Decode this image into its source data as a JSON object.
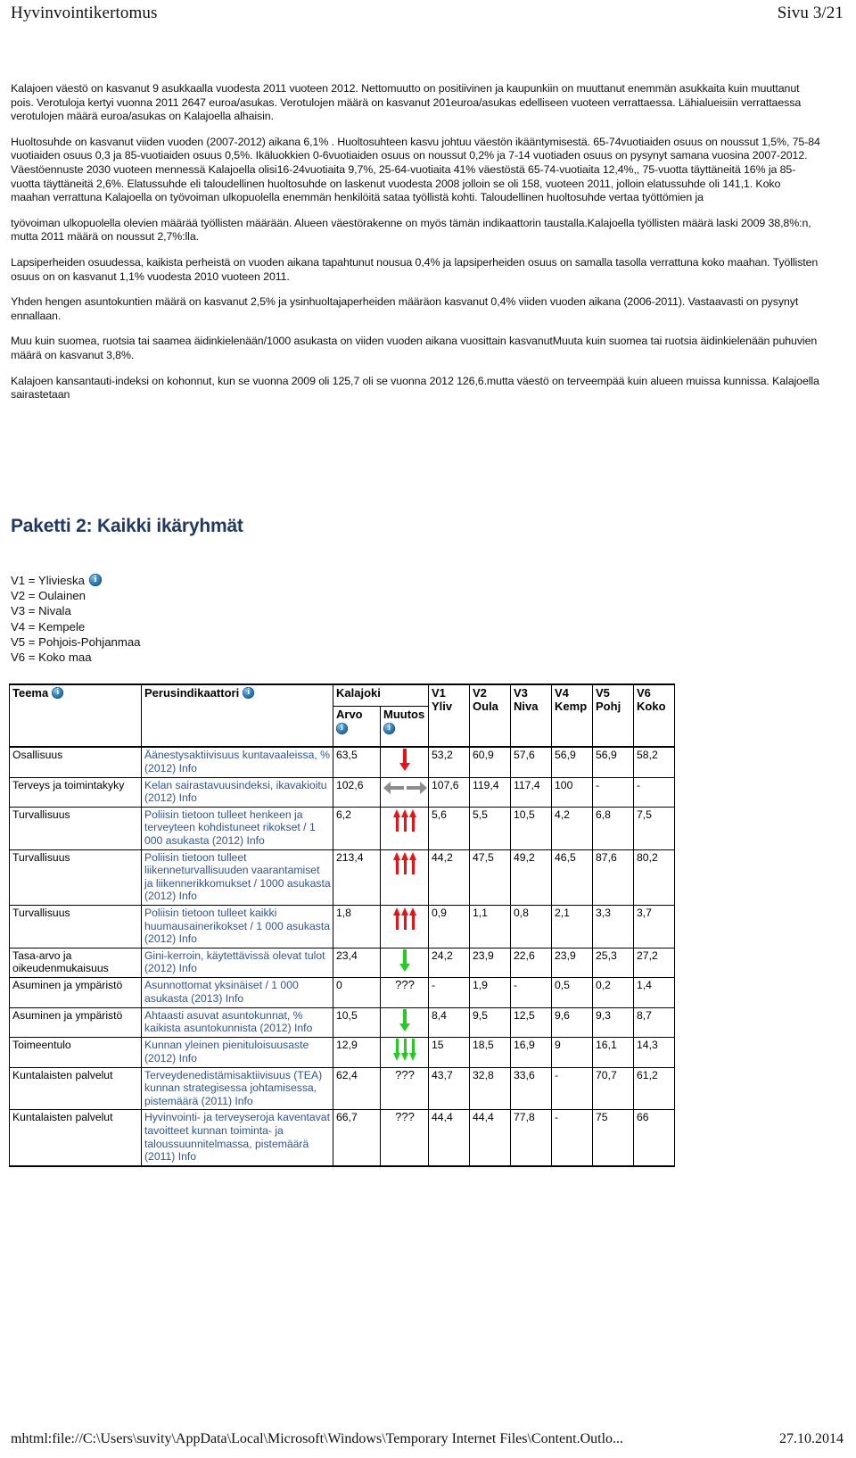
{
  "header": {
    "title": "Hyvinvointikertomus",
    "page_label": "Sivu 3/21"
  },
  "body_paragraphs": [
    "Kalajoen väestö on kasvanut 9 asukkaalla vuodesta 2011 vuoteen 2012. Nettomuutto on positiivinen ja kaupunkiin on muuttanut enemmän asukkaita kuin muuttanut pois. Verotuloja kertyi vuonna 2011  2647 euroa/asukas. Verotulojen määrä on kasvanut 201euroa/asukas edelliseen vuoteen verrattaessa. Lähialueisiin verrattaessa verotulojen määrä euroa/asukas on Kalajoella alhaisin.",
    "Huoltosuhde on kasvanut viiden vuoden (2007-2012) aikana 6,1% . Huoltosuhteen kasvu johtuu väestön ikääntymisestä. 65-74vuotiaiden osuus on noussut 1,5%, 75-84 vuotiaiden osuus 0,3  ja 85-vuotiaiden osuus 0,5%. Ikäluokkien 0-6vuotiaiden osuus on noussut 0,2% ja 7-14 vuotiaden osuus on pysynyt samana vuosina 2007-2012. Väestöennuste 2030 vuoteen mennessä Kalajoella olisi16-24vuotiaita 9,7%, 25-64-vuotiaita 41%  väestöstä  65-74-vuotiaita 12,4%,, 75-vuotta täyttäneitä 16% ja 85-vuotta täyttäneitä 2,6%. Elatussuhde eli taloudellinen huoltosuhde on laskenut vuodesta 2008 jolloin se oli 158, vuoteen 2011, jolloin elatussuhde oli 141,1. Koko maahan verrattuna Kalajoella on työvoiman ulkopuolella enemmän henkilöitä sataa työllistä kohti. Taloudellinen huoltosuhde vertaa työttömien ja",
    "työvoiman ulkopuolella olevien määrää työllisten määrään. Alueen väestörakenne on myös tämän indikaattorin taustalla.Kalajoella työllisten määrä laski 2009 38,8%:n, mutta 2011 määrä on noussut 2,7%:lla.",
    "Lapsiperheiden osuudessa, kaikista perheistä on vuoden aikana tapahtunut nousua 0,4% ja lapsiperheiden osuus on samalla tasolla verrattuna koko maahan. Työllisten osuus on on kasvanut 1,1% vuodesta 2010 vuoteen 2011.",
    "Yhden hengen asuntokuntien määrä on kasvanut 2,5% ja ysinhuoltajaperheiden määräon kasvanut 0,4% viiden vuoden aikana (2006-2011). Vastaavasti on pysynyt ennallaan.",
    "Muu kuin suomea, ruotsia tai saamea äidinkielenään/1000 asukasta on viiden vuoden aikana vuosittain kasvanutMuuta kuin suomea tai ruotsia äidinkielenään puhuvien määrä on kasvanut 3,8%.",
    "Kalajoen  kansantauti-indeksi on kohonnut, kun se vuonna 2009 oli 125,7 oli se vuonna 2012 126,6.mutta väestö on terveempää kuin alueen muissa kunnissa. Kalajoella sairastetaan"
  ],
  "section_heading": "Paketti 2: Kaikki ikäryhmät",
  "legend": {
    "items": [
      "V1 = Ylivieska",
      "V2 = Oulainen",
      "V3 = Nivala",
      "V4 = Kempele",
      "V5 = Pohjois-Pohjanmaa",
      "V6 = Koko maa"
    ],
    "info_icon": "info-icon"
  },
  "table": {
    "headers": {
      "theme": "Teema",
      "indicator": "Perusindikaattori",
      "group_kalajoki": "Kalajoki",
      "arvo": "Arvo",
      "muutos": "Muutos",
      "v1_code": "V1",
      "v1_name": "Yliv",
      "v2_code": "V2",
      "v2_name": "Oula",
      "v3_code": "V3",
      "v3_name": "Niva",
      "v4_code": "V4",
      "v4_name": "Kemp",
      "v5_code": "V5",
      "v5_name": "Pohj",
      "v6_code": "V6",
      "v6_name": "Koko"
    },
    "rows": [
      {
        "theme": "Osallisuus",
        "indicator": "Äänestysaktiivisuus kuntavaaleissa, % (2012) Info",
        "arvo": "63,5",
        "change": {
          "type": "arrow",
          "direction": "down",
          "color": "#ee1111",
          "count": 1,
          "text": ""
        },
        "v1": "53,2",
        "v2": "60,9",
        "v3": "57,6",
        "v4": "56,9",
        "v5": "56,9",
        "v6": "58,2"
      },
      {
        "theme": "Terveys ja toimintakyky",
        "indicator": "Kelan sairastavuusindeksi, ikavakioitu (2012) Info",
        "arvo": "102,6",
        "change": {
          "type": "leftright",
          "direction": "both",
          "color": "#8d8d8d",
          "count": 2,
          "text": ""
        },
        "v1": "107,6",
        "v2": "119,4",
        "v3": "117,4",
        "v4": "100",
        "v5": "-",
        "v6": "-"
      },
      {
        "theme": "Turvallisuus",
        "indicator": "Poliisin tietoon tulleet henkeen ja terveyteen kohdistuneet rikokset / 1 000 asukasta (2012) Info",
        "arvo": "6,2",
        "change": {
          "type": "arrow",
          "direction": "up",
          "color": "#ee1111",
          "count": 3,
          "text": ""
        },
        "v1": "5,6",
        "v2": "5,5",
        "v3": "10,5",
        "v4": "4,2",
        "v5": "6,8",
        "v6": "7,5"
      },
      {
        "theme": "Turvallisuus",
        "indicator": "Poliisin tietoon tulleet liikenneturvallisuuden vaarantamiset ja liikennerikkomukset / 1000 asukasta (2012) Info",
        "arvo": "213,4",
        "change": {
          "type": "arrow",
          "direction": "up",
          "color": "#ee1111",
          "count": 3,
          "text": ""
        },
        "v1": "44,2",
        "v2": "47,5",
        "v3": "49,2",
        "v4": "46,5",
        "v5": "87,6",
        "v6": "80,2"
      },
      {
        "theme": "Turvallisuus",
        "indicator": "Poliisin tietoon tulleet kaikki huumausainerikokset / 1 000 asukasta (2012) Info",
        "arvo": "1,8",
        "change": {
          "type": "arrow",
          "direction": "up",
          "color": "#ee1111",
          "count": 3,
          "text": ""
        },
        "v1": "0,9",
        "v2": "1,1",
        "v3": "0,8",
        "v4": "2,1",
        "v5": "3,3",
        "v6": "3,7"
      },
      {
        "theme": "Tasa-arvo ja oikeudenmukaisuus",
        "indicator": "Gini-kerroin, käytettävissä olevat tulot (2012) Info",
        "arvo": "23,4",
        "change": {
          "type": "arrow",
          "direction": "down",
          "color": "#22cc22",
          "count": 1,
          "text": ""
        },
        "v1": "24,2",
        "v2": "23,9",
        "v3": "22,6",
        "v4": "23,9",
        "v5": "25,3",
        "v6": "27,2"
      },
      {
        "theme": "Asuminen ja ympäristö",
        "indicator": "Asunnottomat yksinäiset / 1 000 asukasta (2013) Info",
        "arvo": "0",
        "change": {
          "type": "text",
          "direction": "",
          "color": "#000000",
          "count": 0,
          "text": "???"
        },
        "v1": "-",
        "v2": "1,9",
        "v3": "-",
        "v4": "0,5",
        "v5": "0,2",
        "v6": "1,4"
      },
      {
        "theme": "Asuminen ja ympäristö",
        "indicator": "Ahtaasti asuvat asuntokunnat, % kaikista asuntokunnista (2012) Info",
        "arvo": "10,5",
        "change": {
          "type": "arrow",
          "direction": "down",
          "color": "#22cc22",
          "count": 1,
          "text": ""
        },
        "v1": "8,4",
        "v2": "9,5",
        "v3": "12,5",
        "v4": "9,6",
        "v5": "9,3",
        "v6": "8,7"
      },
      {
        "theme": "Toimeentulo",
        "indicator": "Kunnan yleinen pienituloisuusaste (2012) Info",
        "arvo": "12,9",
        "change": {
          "type": "arrow",
          "direction": "down",
          "color": "#22cc22",
          "count": 3,
          "text": ""
        },
        "v1": "15",
        "v2": "18,5",
        "v3": "16,9",
        "v4": "9",
        "v5": "16,1",
        "v6": "14,3"
      },
      {
        "theme": "Kuntalaisten palvelut",
        "indicator": "Terveydenedistämisaktiivisuus (TEA) kunnan strategisessa johtamisessa, pistemäärä (2011) Info",
        "arvo": "62,4",
        "change": {
          "type": "text",
          "direction": "",
          "color": "#000000",
          "count": 0,
          "text": "???"
        },
        "v1": "43,7",
        "v2": "32,8",
        "v3": "33,6",
        "v4": "-",
        "v5": "70,7",
        "v6": "61,2"
      },
      {
        "theme": "Kuntalaisten palvelut",
        "indicator": "Hyvinvointi- ja terveyseroja kaventavat tavoitteet kunnan toiminta- ja taloussuunnitelmassa, pistemäärä (2011) Info",
        "arvo": "66,7",
        "change": {
          "type": "text",
          "direction": "",
          "color": "#000000",
          "count": 0,
          "text": "???"
        },
        "v1": "44,4",
        "v2": "44,4",
        "v3": "77,8",
        "v4": "-",
        "v5": "75",
        "v6": "66"
      }
    ]
  },
  "footer": {
    "path": "mhtml:file://C:\\Users\\suvity\\AppData\\Local\\Microsoft\\Windows\\Temporary Internet Files\\Content.Outlo...",
    "date": "27.10.2014"
  },
  "colors": {
    "heading": "#1f3864",
    "link": "#2f5496",
    "arrow_red": "#ee1111",
    "arrow_green": "#22cc22",
    "arrow_gray": "#8d8d8d"
  }
}
